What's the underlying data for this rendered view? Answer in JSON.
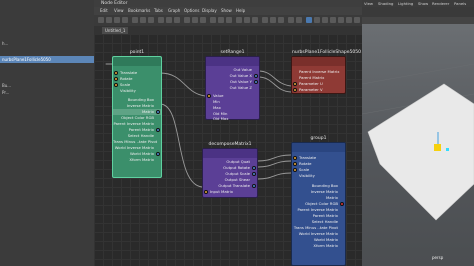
{
  "outliner": {
    "rows": [
      {
        "label": "h...",
        "selected": false
      },
      {
        "label": "nurbsPlane1Follicle5050",
        "selected": true
      },
      {
        "label": "",
        "selected": false
      },
      {
        "label": "Bu...",
        "selected": false
      },
      {
        "label": "Pr...",
        "selected": false
      }
    ]
  },
  "editor": {
    "title": "Node Editor",
    "menu": [
      "Edit",
      "View",
      "Bookmarks",
      "Tabs",
      "Graph",
      "Options",
      "Display",
      "Show",
      "Help"
    ],
    "tabs": [
      "Untitled_1"
    ],
    "nodes": {
      "point1": {
        "title": "point1",
        "attrs": [
          "Translate",
          "Rotate",
          "Scale",
          "Visibility",
          "Bounding Box",
          "Inverse Matrix",
          "Matrix",
          "Object Color RGB",
          "Parent Inverse Matrix",
          "Parent Matrix",
          "Select Handle",
          "Trans Minus ..tate Pivot",
          "World Inverse Matrix",
          "World Matrix",
          "Xform Matrix"
        ]
      },
      "setRange1": {
        "title": "setRange1",
        "outAttrs": [
          "Out Value",
          "Out Value X",
          "Out Value Y",
          "Out Value Z"
        ],
        "inAttrs": [
          "Value",
          "Min",
          "Max",
          "Old Min",
          "Old Max"
        ]
      },
      "follicle": {
        "title": "nurbsPlane1FollicleShape5050",
        "attrs": [
          "Parent Inverse Matrix",
          "Parent Matrix",
          "Parameter U",
          "Parameter V"
        ]
      },
      "decompose": {
        "title": "decomposeMatrix1",
        "attrs": [
          "Output Quat",
          "Output Rotate",
          "Output Scale",
          "Output Shear",
          "Output Translate",
          "Input Matrix"
        ]
      },
      "group1": {
        "title": "group1",
        "attrs": [
          "Translate",
          "Rotate",
          "Scale",
          "Visibility",
          "Bounding Box",
          "Inverse Matrix",
          "Matrix",
          "Object Color RGB",
          "Parent Inverse Matrix",
          "Parent Matrix",
          "Select Handle",
          "Trans Minus ..tate Pivot",
          "World Inverse Matrix",
          "World Matrix",
          "Xform Matrix"
        ]
      }
    }
  },
  "viewport": {
    "menu": [
      "View",
      "Shading",
      "Lighting",
      "Show",
      "Renderer",
      "Panels"
    ],
    "camera": "persp"
  }
}
